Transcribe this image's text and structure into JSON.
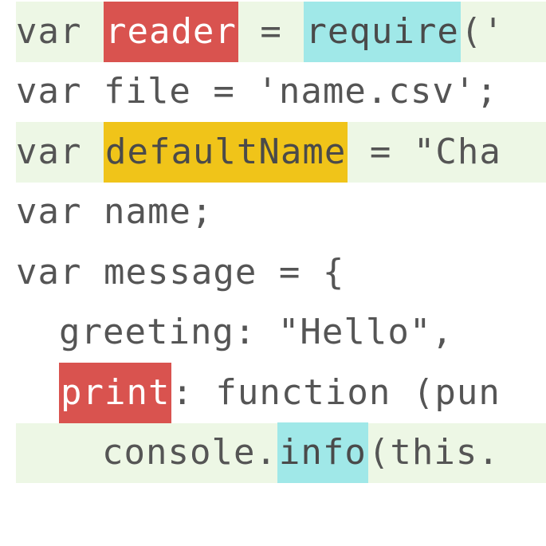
{
  "lines": {
    "l1": {
      "var": "var ",
      "reader": "reader",
      "eq": " = ",
      "require": "require",
      "paren": "('"
    },
    "l2": {
      "text": "var file = 'name.csv';"
    },
    "l3": {
      "var": "var ",
      "defaultName": "defaultName",
      "eq": " = \"Cha"
    },
    "l4": {
      "text": "var name;"
    },
    "l5": {
      "text": "var message = {"
    },
    "l6": {
      "text": "greeting: \"Hello\","
    },
    "l7": {
      "print": "print",
      "rest": ": function (pun"
    },
    "l8": {
      "pre": "console.",
      "info": "info",
      "post": "(this."
    }
  }
}
